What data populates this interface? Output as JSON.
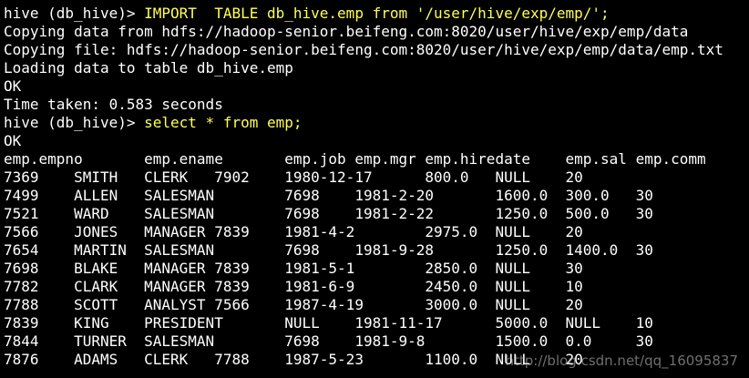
{
  "terminal": {
    "lines": [
      {
        "prompt": "hive (db_hive)> ",
        "command": "IMPORT  TABLE db_hive.emp from '/user/hive/exp/emp/';"
      },
      {
        "text": "Copying data from hdfs://hadoop-senior.beifeng.com:8020/user/hive/exp/emp/data"
      },
      {
        "text": "Copying file: hdfs://hadoop-senior.beifeng.com:8020/user/hive/exp/emp/data/emp.txt"
      },
      {
        "text": "Loading data to table db_hive.emp"
      },
      {
        "text": "OK"
      },
      {
        "text": "Time taken: 0.583 seconds"
      },
      {
        "prompt": "hive (db_hive)> ",
        "command": "select * from emp;"
      },
      {
        "text": "OK"
      },
      {
        "text": "emp.empno       emp.ename       emp.job emp.mgr emp.hiredate    emp.sal emp.comm"
      },
      {
        "text": "7369    SMITH   CLERK   7902    1980-12-17      800.0   NULL    20"
      },
      {
        "text": "7499    ALLEN   SALESMAN        7698    1981-2-20       1600.0  300.0   30"
      },
      {
        "text": "7521    WARD    SALESMAN        7698    1981-2-22       1250.0  500.0   30"
      },
      {
        "text": "7566    JONES   MANAGER 7839    1981-4-2        2975.0  NULL    20"
      },
      {
        "text": "7654    MARTIN  SALESMAN        7698    1981-9-28       1250.0  1400.0  30"
      },
      {
        "text": "7698    BLAKE   MANAGER 7839    1981-5-1        2850.0  NULL    30"
      },
      {
        "text": "7782    CLARK   MANAGER 7839    1981-6-9        2450.0  NULL    10"
      },
      {
        "text": "7788    SCOTT   ANALYST 7566    1987-4-19       3000.0  NULL    20"
      },
      {
        "text": "7839    KING    PRESIDENT       NULL    1981-11-17      5000.0  NULL    10"
      },
      {
        "text": "7844    TURNER  SALESMAN        7698    1981-9-8        1500.0  0.0     30"
      },
      {
        "text": "7876    ADAMS   CLERK   7788    1987-5-23       1100.0  NULL    20"
      }
    ]
  },
  "watermark": "http://blog.csdn.net/qq_16095837",
  "colors": {
    "background": "#000000",
    "text": "#ffffff",
    "command": "#ffff55"
  }
}
